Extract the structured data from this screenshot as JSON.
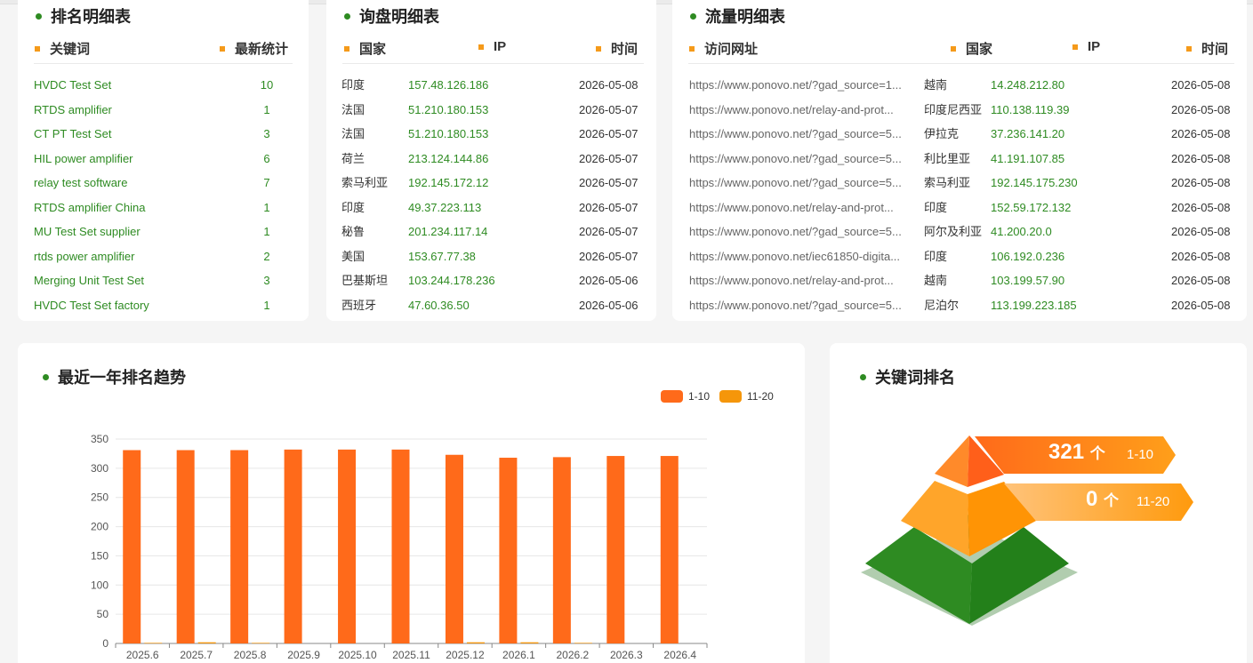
{
  "ranking": {
    "title": "排名明细表",
    "col_keyword": "关键词",
    "col_count": "最新统计",
    "rows": [
      {
        "keyword": "HVDC Test Set",
        "count": "10"
      },
      {
        "keyword": "RTDS amplifier",
        "count": "1"
      },
      {
        "keyword": "CT PT Test Set",
        "count": "3"
      },
      {
        "keyword": "HIL power amplifier",
        "count": "6"
      },
      {
        "keyword": "relay test software",
        "count": "7"
      },
      {
        "keyword": "RTDS amplifier China",
        "count": "1"
      },
      {
        "keyword": "MU Test Set supplier",
        "count": "1"
      },
      {
        "keyword": "rtds power amplifier",
        "count": "2"
      },
      {
        "keyword": "Merging Unit Test Set",
        "count": "3"
      },
      {
        "keyword": "HVDC Test Set factory",
        "count": "1"
      }
    ]
  },
  "inquiry": {
    "title": "询盘明细表",
    "col_country": "国家",
    "col_ip": "IP",
    "col_time": "时间",
    "rows": [
      {
        "country": "印度",
        "ip": "157.48.126.186",
        "time": "2026-05-08"
      },
      {
        "country": "法国",
        "ip": "51.210.180.153",
        "time": "2026-05-07"
      },
      {
        "country": "法国",
        "ip": "51.210.180.153",
        "time": "2026-05-07"
      },
      {
        "country": "荷兰",
        "ip": "213.124.144.86",
        "time": "2026-05-07"
      },
      {
        "country": "索马利亚",
        "ip": "192.145.172.12",
        "time": "2026-05-07"
      },
      {
        "country": "印度",
        "ip": "49.37.223.113",
        "time": "2026-05-07"
      },
      {
        "country": "秘鲁",
        "ip": "201.234.117.14",
        "time": "2026-05-07"
      },
      {
        "country": "美国",
        "ip": "153.67.77.38",
        "time": "2026-05-07"
      },
      {
        "country": "巴基斯坦",
        "ip": "103.244.178.236",
        "time": "2026-05-06"
      },
      {
        "country": "西班牙",
        "ip": "47.60.36.50",
        "time": "2026-05-06"
      }
    ]
  },
  "traffic": {
    "title": "流量明细表",
    "col_url": "访问网址",
    "col_country": "国家",
    "col_ip": "IP",
    "col_time": "时间",
    "rows": [
      {
        "url": "https://www.ponovo.net/?gad_source=1...",
        "country": "越南",
        "ip": "14.248.212.80",
        "time": "2026-05-08"
      },
      {
        "url": "https://www.ponovo.net/relay-and-prot...",
        "country": "印度尼西亚",
        "ip": "110.138.119.39",
        "time": "2026-05-08"
      },
      {
        "url": "https://www.ponovo.net/?gad_source=5...",
        "country": "伊拉克",
        "ip": "37.236.141.20",
        "time": "2026-05-08"
      },
      {
        "url": "https://www.ponovo.net/?gad_source=5...",
        "country": "利比里亚",
        "ip": "41.191.107.85",
        "time": "2026-05-08"
      },
      {
        "url": "https://www.ponovo.net/?gad_source=5...",
        "country": "索马利亚",
        "ip": "192.145.175.230",
        "time": "2026-05-08"
      },
      {
        "url": "https://www.ponovo.net/relay-and-prot...",
        "country": "印度",
        "ip": "152.59.172.132",
        "time": "2026-05-08"
      },
      {
        "url": "https://www.ponovo.net/?gad_source=5...",
        "country": "阿尔及利亚",
        "ip": "41.200.20.0",
        "time": "2026-05-08"
      },
      {
        "url": "https://www.ponovo.net/iec61850-digita...",
        "country": "印度",
        "ip": "106.192.0.236",
        "time": "2026-05-08"
      },
      {
        "url": "https://www.ponovo.net/relay-and-prot...",
        "country": "越南",
        "ip": "103.199.57.90",
        "time": "2026-05-08"
      },
      {
        "url": "https://www.ponovo.net/?gad_source=5...",
        "country": "尼泊尔",
        "ip": "113.199.223.185",
        "time": "2026-05-08"
      }
    ]
  },
  "trend": {
    "title": "最近一年排名趋势"
  },
  "pyramid": {
    "title": "关键词排名",
    "tier1_count": "321",
    "tier1_unit": "个",
    "tier1_label": "1-10",
    "tier2_count": "0",
    "tier2_unit": "个",
    "tier2_label": "11-20"
  },
  "colors": {
    "accent_green": "#2e8b22",
    "bar_top10": "#ff6a1a",
    "bar_top20": "#f5960a",
    "header_marker": "#f59a1a"
  },
  "chart_data": {
    "type": "bar",
    "categories": [
      "2025.6",
      "2025.7",
      "2025.8",
      "2025.9",
      "2025.10",
      "2025.11",
      "2025.12",
      "2026.1",
      "2026.2",
      "2026.3",
      "2026.4"
    ],
    "series": [
      {
        "name": "1-10",
        "color": "#ff6a1a",
        "values": [
          331,
          331,
          331,
          332,
          332,
          332,
          323,
          318,
          319,
          321,
          321
        ]
      },
      {
        "name": "11-20",
        "color": "#f5960a",
        "values": [
          1,
          2,
          1,
          0,
          0,
          0,
          2,
          2,
          1,
          0,
          0
        ]
      }
    ],
    "yticks": [
      0,
      50,
      100,
      150,
      200,
      250,
      300,
      350
    ],
    "ylim": [
      0,
      350
    ],
    "legend_position": "top-right",
    "grid": true
  }
}
